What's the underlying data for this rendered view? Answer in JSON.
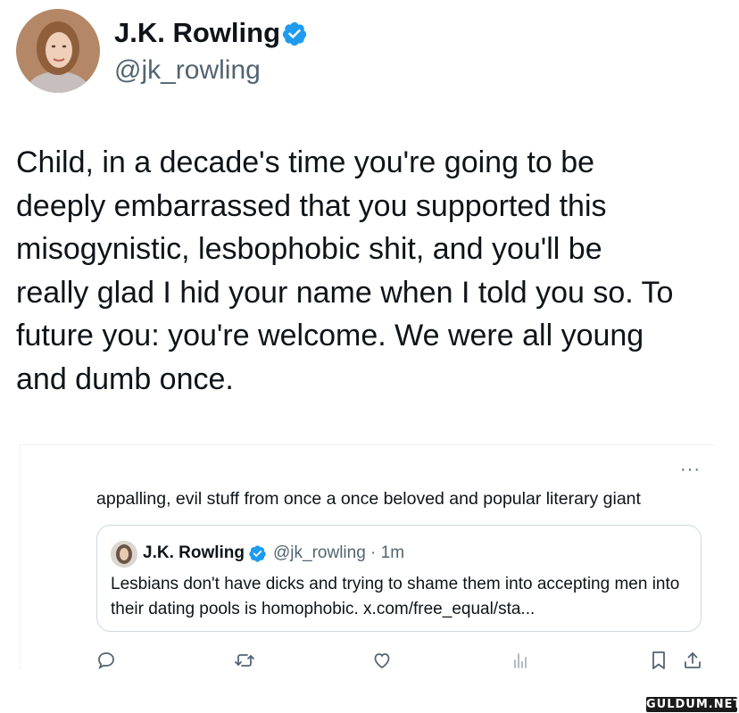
{
  "author": {
    "name": "J.K. Rowling",
    "handle": "@jk_rowling"
  },
  "tweet": {
    "text": "Child, in a decade's time you're going to be\ndeeply embarrassed that you supported this\nmisogynistic, lesbophobic shit, and you'll be\nreally glad I hid your name when I told you so. To\nfuture you: you're welcome. We were all young\nand dumb once."
  },
  "card": {
    "more_icon": "more-dots-icon",
    "reply_text": "appalling, evil stuff from once a once beloved and popular literary giant",
    "quoted": {
      "name": "J.K. Rowling",
      "handle_time": "@jk_rowling · 1m",
      "text": "Lesbians don't have dicks and trying to shame them into accepting men into their dating pools is homophobic. x.com/free_equal/sta..."
    },
    "actions": [
      "reply-icon",
      "retweet-icon",
      "like-icon",
      "views-icon",
      "bookmark-icon",
      "share-icon"
    ]
  },
  "watermark": "GULDUM.NET",
  "colors": {
    "verified": "#1d9bf0",
    "secondary_text": "#536471",
    "border": "#cfd9de"
  }
}
